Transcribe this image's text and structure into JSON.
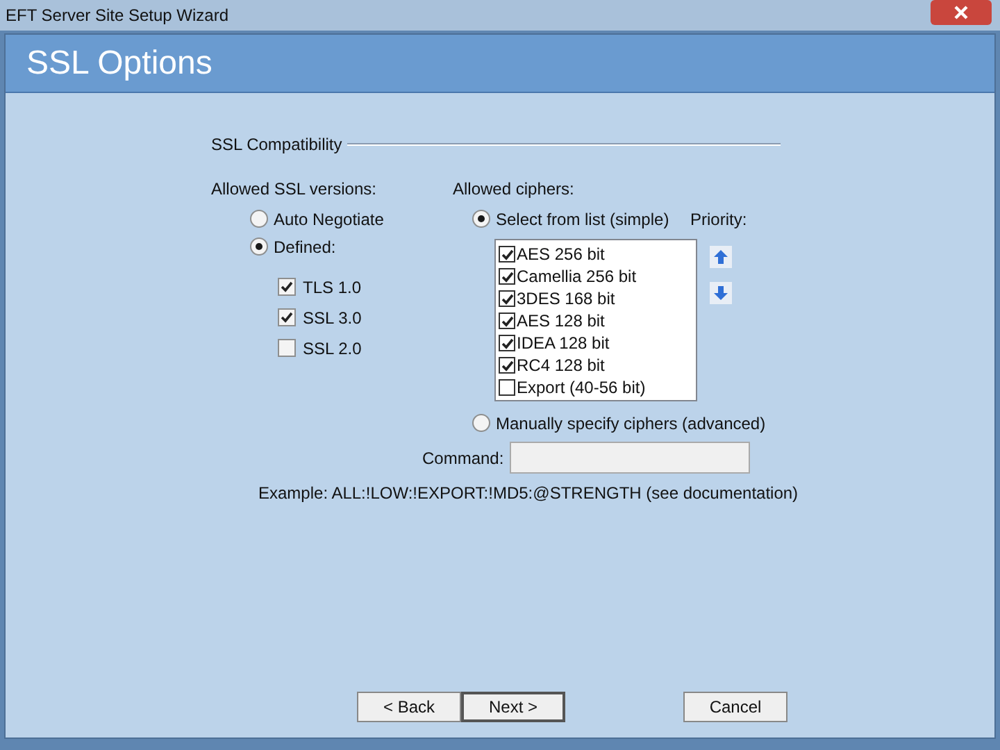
{
  "window": {
    "title": "EFT Server Site Setup Wizard"
  },
  "header": {
    "title": "SSL Options"
  },
  "group": {
    "title": "SSL Compatibility"
  },
  "versions": {
    "label": "Allowed SSL versions:",
    "modes": [
      {
        "label": "Auto Negotiate",
        "selected": false
      },
      {
        "label": "Defined:",
        "selected": true
      }
    ],
    "items": [
      {
        "label": "TLS 1.0",
        "checked": true
      },
      {
        "label": "SSL 3.0",
        "checked": true
      },
      {
        "label": "SSL 2.0",
        "checked": false
      }
    ]
  },
  "ciphers": {
    "label": "Allowed ciphers:",
    "simple": {
      "label": "Select from list (simple)",
      "selected": true
    },
    "priority_label": "Priority:",
    "list": [
      {
        "label": "AES 256 bit",
        "checked": true
      },
      {
        "label": "Camellia 256 bit",
        "checked": true
      },
      {
        "label": "3DES 168 bit",
        "checked": true
      },
      {
        "label": "AES 128 bit",
        "checked": true
      },
      {
        "label": "IDEA 128 bit",
        "checked": true
      },
      {
        "label": "RC4 128 bit",
        "checked": true
      },
      {
        "label": "Export (40-56 bit)",
        "checked": false
      }
    ],
    "manual": {
      "label": "Manually specify ciphers (advanced)",
      "selected": false
    },
    "command_label": "Command:",
    "example": "Example: ALL:!LOW:!EXPORT:!MD5:@STRENGTH  (see documentation)"
  },
  "buttons": [
    {
      "label": "< Back",
      "default": false
    },
    {
      "label": "Next >",
      "default": true
    },
    {
      "label": "Cancel",
      "default": false
    }
  ]
}
